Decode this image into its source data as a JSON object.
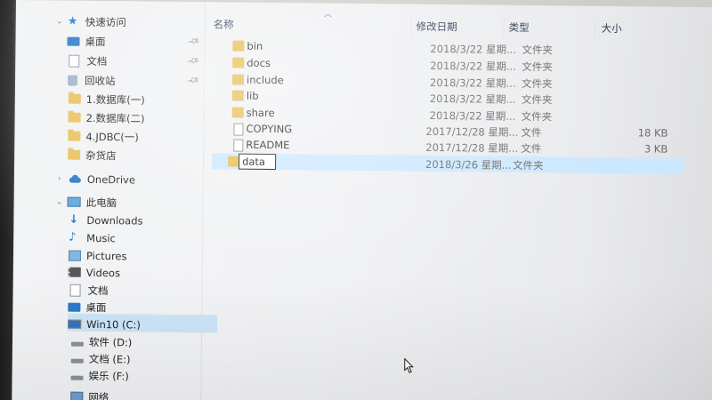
{
  "sidebar": {
    "quick_access": "快速访问",
    "pinned": [
      {
        "label": "桌面",
        "icon": "desktop-icon"
      },
      {
        "label": "文档",
        "icon": "documents-icon"
      },
      {
        "label": "回收站",
        "icon": "recycle-bin-icon"
      }
    ],
    "folders": [
      "1.数据库(一)",
      "2.数据库(二)",
      "4.JDBC(一)",
      "杂货店"
    ],
    "onedrive": "OneDrive",
    "this_pc": "此电脑",
    "pc_items": [
      "Downloads",
      "Music",
      "Pictures",
      "Videos",
      "文档",
      "桌面"
    ],
    "drives": [
      "Win10 (C:)",
      "软件 (D:)",
      "文档 (E:)",
      "娱乐 (F:)"
    ],
    "network": "网络"
  },
  "header": {
    "name": "名称",
    "date": "修改日期",
    "type": "类型",
    "size": "大小"
  },
  "files": [
    {
      "name": "bin",
      "date": "2018/3/22 星期...",
      "type": "文件夹",
      "size": "",
      "kind": "folder"
    },
    {
      "name": "docs",
      "date": "2018/3/22 星期...",
      "type": "文件夹",
      "size": "",
      "kind": "folder"
    },
    {
      "name": "include",
      "date": "2018/3/22 星期...",
      "type": "文件夹",
      "size": "",
      "kind": "folder"
    },
    {
      "name": "lib",
      "date": "2018/3/22 星期...",
      "type": "文件夹",
      "size": "",
      "kind": "folder"
    },
    {
      "name": "share",
      "date": "2018/3/22 星期...",
      "type": "文件夹",
      "size": "",
      "kind": "folder"
    },
    {
      "name": "COPYING",
      "date": "2017/12/28 星期...",
      "type": "文件",
      "size": "18 KB",
      "kind": "file"
    },
    {
      "name": "README",
      "date": "2017/12/28 星期...",
      "type": "文件",
      "size": "3 KB",
      "kind": "file"
    },
    {
      "name": "data",
      "date": "2018/3/26 星期...",
      "type": "文件夹",
      "size": "",
      "kind": "folder"
    }
  ],
  "colors": {
    "selection": "#cce8ff",
    "folder": "#e7bd52",
    "accent": "#2a76c4"
  }
}
